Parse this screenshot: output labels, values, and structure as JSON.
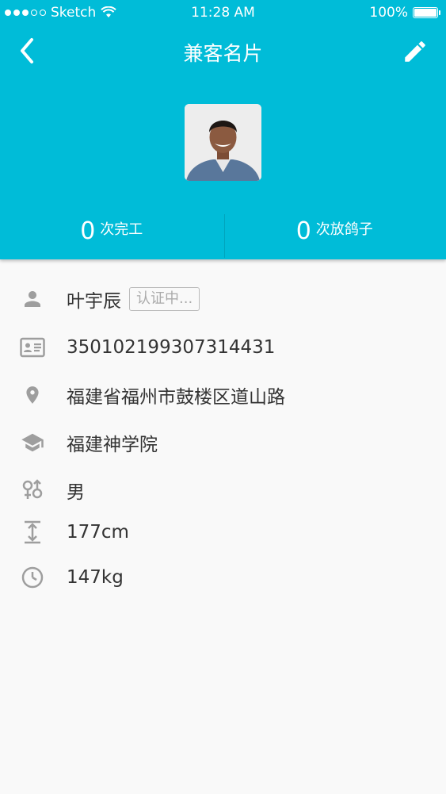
{
  "status_bar": {
    "carrier": "Sketch",
    "time": "11:28 AM",
    "battery": "100%"
  },
  "nav": {
    "title": "兼客名片"
  },
  "stats": [
    {
      "num": "0",
      "label": "次完工"
    },
    {
      "num": "0",
      "label": "次放鸽子"
    }
  ],
  "profile": {
    "name": "叶宇辰",
    "verify_status": "认证中...",
    "id_number": "350102199307314431",
    "address": "福建省福州市鼓楼区道山路",
    "school": "福建神学院",
    "gender": "男",
    "height": "177cm",
    "weight": "147kg"
  },
  "icons": {
    "back": "chevron-left-icon",
    "edit": "pencil-icon",
    "name": "person-icon",
    "id": "id-card-icon",
    "address": "location-pin-icon",
    "school": "graduation-cap-icon",
    "gender": "gender-icon",
    "height": "height-icon",
    "weight": "scale-icon"
  },
  "colors": {
    "header": "#00bcd8",
    "icon": "#9e9e9e",
    "text": "#333333"
  }
}
